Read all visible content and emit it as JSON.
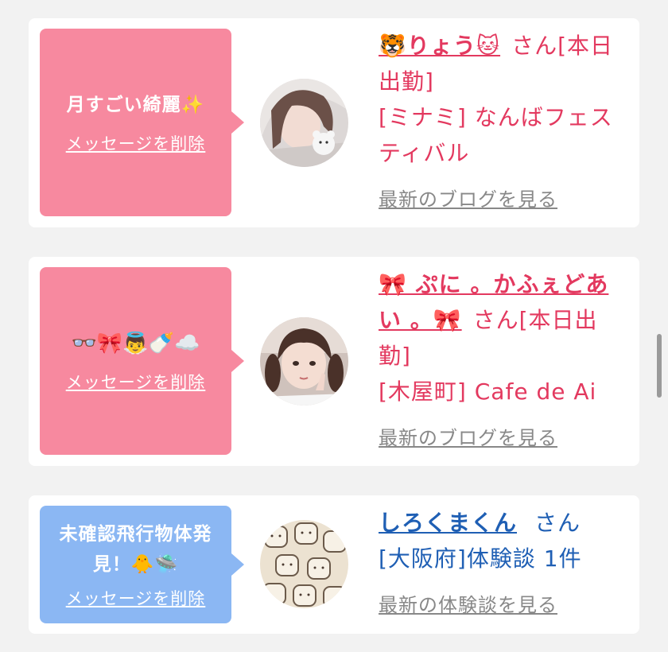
{
  "cards": [
    {
      "bubble_message": "月すごい綺麗✨",
      "delete_label": "メッセージを削除",
      "name": "🐯りょう🐱",
      "suffix": "さん[本日出勤]",
      "location": "[ミナミ] なんばフェスティバル",
      "link": "最新のブログを見る",
      "theme_color": "#f7899f"
    },
    {
      "bubble_message": "👓🎀👼🍼☁️",
      "delete_label": "メッセージを削除",
      "name": "🎀 ぷに 。かふぇどあい 。🎀",
      "suffix": "さん[本日出勤]",
      "location": "[木屋町] Cafe de Ai",
      "link": "最新のブログを見る",
      "theme_color": "#f7899f"
    },
    {
      "bubble_message": "未確認飛行物体発見！🐥🛸",
      "delete_label": "メッセージを削除",
      "name": "しろくまくん",
      "suffix": "さん",
      "location": "[大阪府]体験談 1件",
      "link": "最新の体験談を見る",
      "theme_color": "#8bb7f3"
    }
  ]
}
